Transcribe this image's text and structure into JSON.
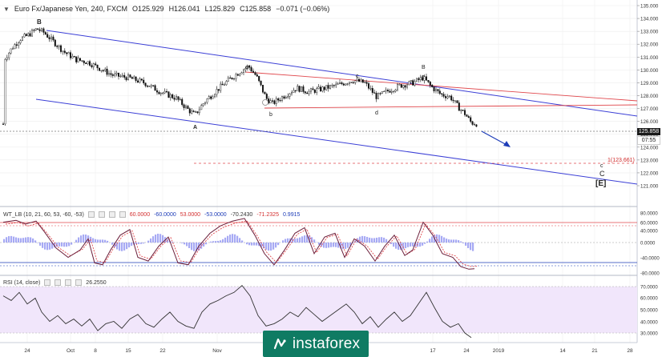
{
  "header": {
    "symbol": "Euro Fx/Japanese Yen, 240, FXCM",
    "open": "O125.929",
    "high": "H126.041",
    "low": "L125.829",
    "close": "C125.858",
    "change": "−0.071 (−0.06%)"
  },
  "price_axis": {
    "ticks": [
      "135.000",
      "134.000",
      "133.000",
      "132.000",
      "131.000",
      "130.000",
      "129.000",
      "128.000",
      "127.000",
      "126.000",
      "125.000",
      "124.000",
      "123.000",
      "122.000",
      "121.000"
    ],
    "current_price": "125.858",
    "countdown": "07:55"
  },
  "time_axis": {
    "labels": [
      "24",
      "Oct",
      "8",
      "15",
      "22",
      "Nov",
      "17",
      "24",
      "2019",
      "14",
      "21",
      "28"
    ]
  },
  "annotations": {
    "wave_labels": [
      "B",
      "a",
      "A",
      "b",
      "c",
      "d",
      "B",
      "e",
      "C",
      "[E]"
    ],
    "target_label": "1(123.661)"
  },
  "wt_lb": {
    "title": "WT_LB (10, 21, 60, 53, -60, -53)",
    "values": [
      "60.0000",
      "-60.0000",
      "53.0000",
      "-53.0000",
      "-70.2430",
      "-71.2325",
      "0.9915"
    ],
    "axis": [
      "80.0000",
      "60.0000",
      "40.0000",
      "0.0000",
      "-40.0000",
      "-80.0000"
    ]
  },
  "rsi": {
    "title": "RSI (14, close)",
    "value": "26.2550",
    "axis": [
      "70.0000",
      "60.0000",
      "50.0000",
      "40.0000",
      "30.0000"
    ]
  },
  "logo": {
    "text": "instaforex"
  },
  "colors": {
    "channel": "#3b3fd6",
    "triangle": "#e0474c",
    "wt_dashed": "#e0474c",
    "wt_blue": "#8a8df0",
    "rsi_bg": "#f1e6fb",
    "logo_bg": "#0f7b63"
  },
  "chart_data": {
    "type": "candlestick",
    "timeframe": "240",
    "current_price": 125.858,
    "price_range": [
      121,
      135
    ],
    "wave_points": [
      {
        "label": "B",
        "price": 133.2
      },
      {
        "label": "A",
        "price": 126.5
      },
      {
        "label": "a",
        "price": 130.4
      },
      {
        "label": "b",
        "price": 127.3
      },
      {
        "label": "c",
        "price": 129.4
      },
      {
        "label": "d",
        "price": 127.6
      },
      {
        "label": "e",
        "price": 129.4
      },
      {
        "label": "C",
        "price": 122.6
      },
      {
        "label": "[E]",
        "price": 121.8
      }
    ],
    "target": 123.661,
    "wt_lb_levels": [
      60,
      -60,
      53,
      -53
    ],
    "wt_lb_values": [
      -70.243,
      -71.2325,
      0.9915
    ],
    "rsi_value": 26.255,
    "rsi_band": [
      30,
      70
    ]
  }
}
